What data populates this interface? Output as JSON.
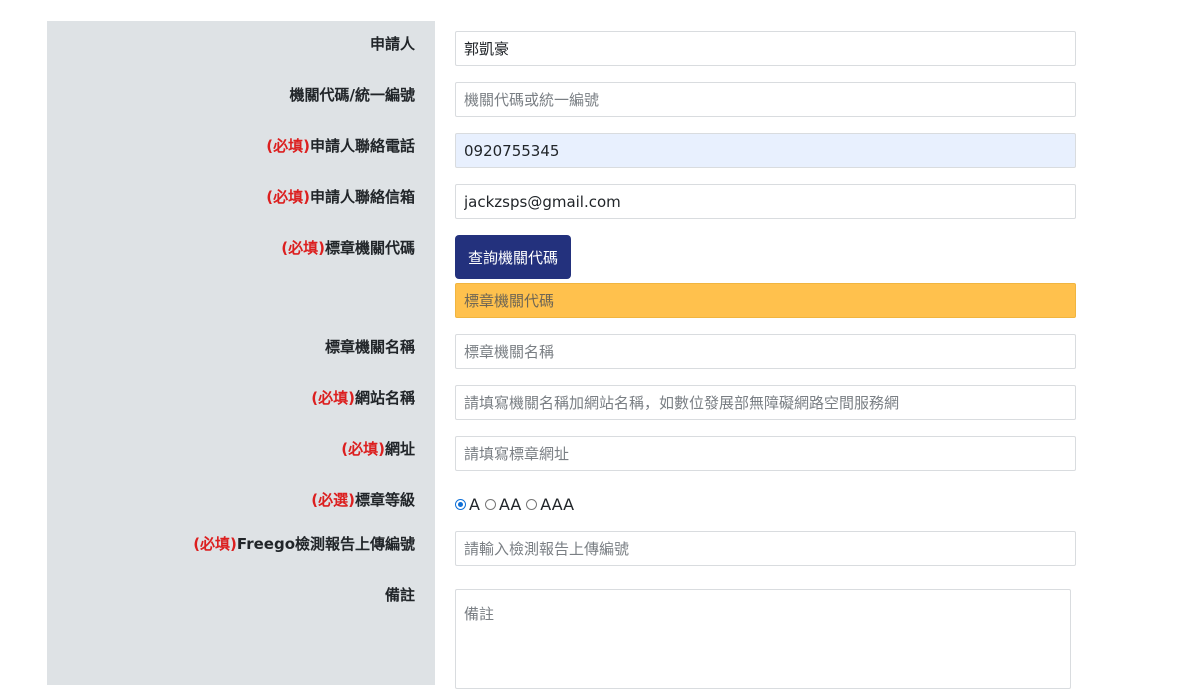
{
  "labels": {
    "applicant": "申請人",
    "agency_code": "機關代碼/統一編號",
    "phone_req": "(必填)",
    "phone": "申請人聯絡電話",
    "email_req": "(必填)",
    "email": "申請人聯絡信箱",
    "badge_code_req": "(必填)",
    "badge_code": "標章機關代碼",
    "badge_name": "標章機關名稱",
    "site_name_req": "(必填)",
    "site_name": "網站名稱",
    "url_req": "(必填)",
    "url": "網址",
    "level_req": "(必選)",
    "level": "標章等級",
    "report_req": "(必填)",
    "report": "Freego檢測報告上傳編號",
    "note": "備註"
  },
  "fields": {
    "applicant_value": "郭凱豪",
    "agency_code_placeholder": "機關代碼或統一編號",
    "phone_value": "0920755345",
    "email_value": "jackzsps@gmail.com",
    "badge_code_placeholder": "標章機關代碼",
    "badge_name_placeholder": "標章機關名稱",
    "site_name_placeholder": "請填寫機關名稱加網站名稱，如數位發展部無障礙網路空間服務網",
    "url_placeholder": "請填寫標章網址",
    "report_placeholder": "請輸入檢測報告上傳編號",
    "note_placeholder": "備註"
  },
  "buttons": {
    "lookup_code": "查詢機關代碼"
  },
  "level_options": {
    "selected": "A",
    "a": "A",
    "aa": "AA",
    "aaa": "AAA"
  },
  "colors": {
    "required": "#dc1f1f",
    "button": "#23317d",
    "highlight": "#ffc14d",
    "autofill": "#e8f0fe"
  }
}
